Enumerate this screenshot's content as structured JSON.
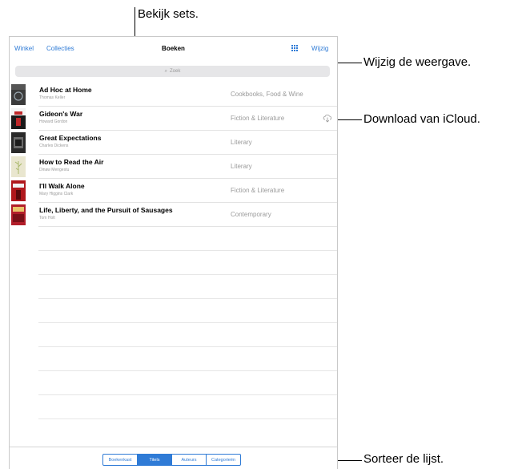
{
  "colors": {
    "accent": "#2f7bd6",
    "secondary_text": "#9a9a9a",
    "separator": "#e3e3e3"
  },
  "navbar": {
    "left_links": [
      "Winkel",
      "Collecties"
    ],
    "title": "Boeken",
    "grid_icon": "grid-icon",
    "edit_label": "Wijzig"
  },
  "search": {
    "placeholder": "Zoek",
    "icon": "search-icon"
  },
  "books": [
    {
      "title": "Ad Hoc at Home",
      "author": "Thomas Keller",
      "category": "Cookbooks, Food & Wine",
      "cover_color": "#3b3b3b",
      "cover_accent": "#9aa7b0",
      "download": false
    },
    {
      "title": "Gideon's War",
      "author": "Howard Gordon",
      "category": "Fiction & Literature",
      "cover_color": "#1a1a1a",
      "cover_accent": "#c0282a",
      "download": true
    },
    {
      "title": "Great Expectations",
      "author": "Charles Dickens",
      "category": "Literary",
      "cover_color": "#2a2a2a",
      "cover_accent": "#6a6a6a",
      "download": false
    },
    {
      "title": "How to Read the Air",
      "author": "Dinaw Mengestu",
      "category": "Literary",
      "cover_color": "#e9e6cf",
      "cover_accent": "#a9b86a",
      "download": false
    },
    {
      "title": "I'll Walk Alone",
      "author": "Mary Higgins Clark",
      "category": "Fiction & Literature",
      "cover_color": "#b0171c",
      "cover_accent": "#f2f2f2",
      "download": false
    },
    {
      "title": "Life, Liberty, and the Pursuit of Sausages",
      "author": "Tom Holt",
      "category": "Contemporary",
      "cover_color": "#b21e2a",
      "cover_accent": "#e9c46a",
      "download": false
    }
  ],
  "segmented_control": {
    "options": [
      "Boekenkast",
      "Titels",
      "Auteurs",
      "Categorieën"
    ],
    "selected": "Titels"
  },
  "callouts": {
    "sets": "Bekijk sets.",
    "view": "Wijzig de weergave.",
    "icloud": "Download van iCloud.",
    "sort": "Sorteer de lijst."
  }
}
